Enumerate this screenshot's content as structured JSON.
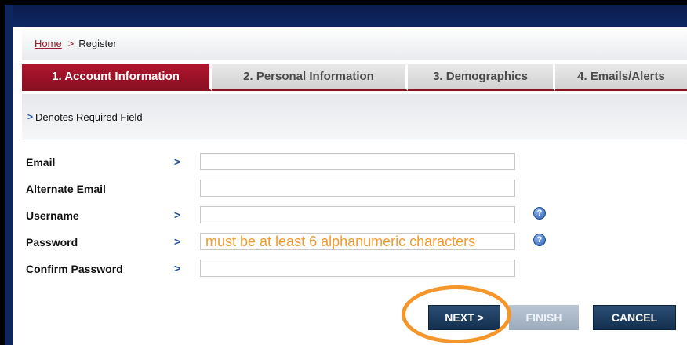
{
  "breadcrumb": {
    "home": "Home",
    "separator": ">",
    "current": "Register"
  },
  "tabs": [
    {
      "label": "1. Account Information",
      "active": true
    },
    {
      "label": "2. Personal Information",
      "active": false
    },
    {
      "label": "3. Demographics",
      "active": false
    },
    {
      "label": "4. Emails/Alerts",
      "active": false
    }
  ],
  "required_note": {
    "chevron": ">",
    "text": "Denotes Required Field"
  },
  "form": {
    "email": {
      "label": "Email",
      "required": ">",
      "value": ""
    },
    "alt_email": {
      "label": "Alternate Email",
      "value": ""
    },
    "username": {
      "label": "Username",
      "required": ">",
      "value": "",
      "help": "?"
    },
    "password": {
      "label": "Password",
      "required": ">",
      "value": "must be at least 6 alphanumeric characters",
      "help": "?"
    },
    "confirm_password": {
      "label": "Confirm Password",
      "required": ">",
      "value": ""
    }
  },
  "buttons": {
    "next": "NEXT >",
    "finish": "FINISH",
    "cancel": "CANCEL"
  },
  "colors": {
    "active_tab": "#9b1328",
    "navy": "#0f2a66",
    "button_dark": "#1c3a5c",
    "hint_orange": "#f29a2e",
    "highlight": "#f5962a"
  }
}
